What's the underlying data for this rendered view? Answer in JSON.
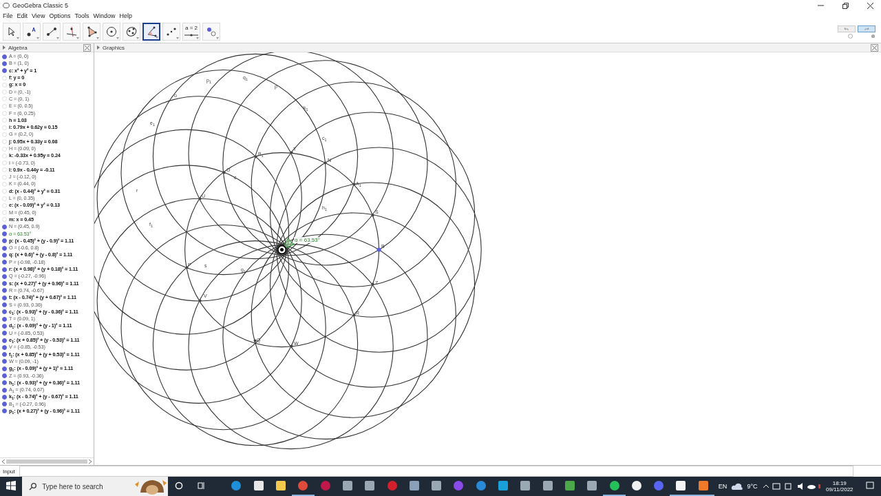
{
  "window": {
    "title": "GeoGebra Classic 5"
  },
  "menu": [
    "File",
    "Edit",
    "View",
    "Options",
    "Tools",
    "Window",
    "Help"
  ],
  "tools": [
    {
      "kind": "move",
      "selected": false
    },
    {
      "kind": "point",
      "selected": false
    },
    {
      "kind": "segment",
      "selected": false
    },
    {
      "kind": "perpendicular",
      "selected": false
    },
    {
      "kind": "polygon",
      "selected": false
    },
    {
      "kind": "circle",
      "selected": false
    },
    {
      "kind": "conic",
      "selected": false
    },
    {
      "kind": "angle",
      "selected": true
    },
    {
      "kind": "reflect",
      "selected": false
    },
    {
      "kind": "slider",
      "selected": false,
      "label": "a = 2"
    },
    {
      "kind": "show",
      "selected": false
    }
  ],
  "algebra": {
    "title": "Algebra",
    "rows": [
      {
        "text": "A = (0, 0)",
        "kind": "point",
        "visible": true
      },
      {
        "text": "B = (1, 0)",
        "kind": "point",
        "visible": true
      },
      {
        "text": "c: x² + y² = 1",
        "kind": "object",
        "visible": true
      },
      {
        "text": "f: y = 0",
        "kind": "object",
        "visible": false
      },
      {
        "text": "g: x = 0",
        "kind": "object",
        "visible": false
      },
      {
        "text": "D = (0, -1)",
        "kind": "point",
        "visible": false
      },
      {
        "text": "C = (0, 1)",
        "kind": "point",
        "visible": false
      },
      {
        "text": "E = (0, 0.5)",
        "kind": "point",
        "visible": false
      },
      {
        "text": "F = (0, 0.25)",
        "kind": "point",
        "visible": false
      },
      {
        "text": "h = 1.03",
        "kind": "object",
        "visible": false
      },
      {
        "text": "i: 0.79x + 0.62y = 0.15",
        "kind": "object",
        "visible": false
      },
      {
        "text": "G = (0.2, 0)",
        "kind": "point",
        "visible": false
      },
      {
        "text": "j: 0.95x + 0.33y = 0.08",
        "kind": "object",
        "visible": false
      },
      {
        "text": "H = (0.09, 0)",
        "kind": "point",
        "visible": false
      },
      {
        "text": "k: -0.33x + 0.95y = 0.24",
        "kind": "object",
        "visible": false
      },
      {
        "text": "I = (-0.73, 0)",
        "kind": "point",
        "visible": false
      },
      {
        "text": "l: 0.9x - 0.44y = -0.11",
        "kind": "object",
        "visible": false
      },
      {
        "text": "J = (-0.12, 0)",
        "kind": "point",
        "visible": false
      },
      {
        "text": "K = (0.44, 0)",
        "kind": "point",
        "visible": false
      },
      {
        "text": "d: (x - 0.44)² + y² = 0.31",
        "kind": "object",
        "visible": false
      },
      {
        "text": "L = (0, 0.35)",
        "kind": "point",
        "visible": false
      },
      {
        "text": "e: (x - 0.09)² + y² = 0.13",
        "kind": "object",
        "visible": false
      },
      {
        "text": "M = (0.45, 0)",
        "kind": "point",
        "visible": false
      },
      {
        "text": "m: x = 0.45",
        "kind": "object",
        "visible": false
      },
      {
        "text": "N = (0.45, 0.9)",
        "kind": "point",
        "visible": true
      },
      {
        "text": "α = 63.53°",
        "kind": "angle",
        "visible": true
      },
      {
        "text": "p: (x - 0.45)² + (y - 0.9)² = 1.11",
        "kind": "object",
        "visible": true
      },
      {
        "text": "O = (-0.6, 0.8)",
        "kind": "point",
        "visible": true
      },
      {
        "text": "q: (x + 0.6)² + (y - 0.8)² = 1.11",
        "kind": "object",
        "visible": true
      },
      {
        "text": "P = (-0.98, -0.18)",
        "kind": "point",
        "visible": true
      },
      {
        "text": "r: (x + 0.98)² + (y + 0.18)² = 1.11",
        "kind": "object",
        "visible": true
      },
      {
        "text": "Q = (-0.27, -0.96)",
        "kind": "point",
        "visible": true
      },
      {
        "text": "s: (x + 0.27)² + (y + 0.96)² = 1.11",
        "kind": "object",
        "visible": true
      },
      {
        "text": "R = (0.74, -0.67)",
        "kind": "point",
        "visible": true
      },
      {
        "text": "t: (x - 0.74)² + (y + 0.67)² = 1.11",
        "kind": "object",
        "visible": true
      },
      {
        "text": "S = (0.93, 0.36)",
        "kind": "point",
        "visible": true
      },
      {
        "text": "c$_{1}$: (x - 0.93)² + (y - 0.36)² = 1.11",
        "kind": "object",
        "visible": true
      },
      {
        "text": "T = (0.09, 1)",
        "kind": "point",
        "visible": true
      },
      {
        "text": "d$_{1}$: (x - 0.09)² + (y - 1)² = 1.11",
        "kind": "object",
        "visible": true
      },
      {
        "text": "U = (-0.85, 0.53)",
        "kind": "point",
        "visible": true
      },
      {
        "text": "e$_{1}$: (x + 0.85)² + (y - 0.53)² = 1.11",
        "kind": "object",
        "visible": true
      },
      {
        "text": "V = (-0.85, -0.53)",
        "kind": "point",
        "visible": true
      },
      {
        "text": "f$_{1}$: (x + 0.85)² + (y + 0.53)² = 1.11",
        "kind": "object",
        "visible": true
      },
      {
        "text": "W = (0.09, -1)",
        "kind": "point",
        "visible": true
      },
      {
        "text": "g$_{1}$: (x - 0.09)² + (y + 1)² = 1.11",
        "kind": "object",
        "visible": true
      },
      {
        "text": "Z = (0.93, -0.36)",
        "kind": "point",
        "visible": true
      },
      {
        "text": "h$_{1}$: (x - 0.93)² + (y + 0.36)² = 1.11",
        "kind": "object",
        "visible": true
      },
      {
        "text": "A$_{1}$ = (0.74, 0.67)",
        "kind": "point",
        "visible": true
      },
      {
        "text": "k$_{1}$: (x - 0.74)² + (y - 0.67)² = 1.11",
        "kind": "object",
        "visible": true
      },
      {
        "text": "B$_{1}$ = (-0.27, 0.96)",
        "kind": "point",
        "visible": true
      },
      {
        "text": "p$_{1}$: (x + 0.27)² + (y - 0.96)² = 1.11",
        "kind": "object",
        "visible": true
      }
    ]
  },
  "graphics": {
    "title": "Graphics",
    "angle_label": "α = 63.53°",
    "labels": [
      {
        "text": "o"
      },
      {
        "text": "p$_{1}$"
      },
      {
        "text": "q$_{1}$"
      },
      {
        "text": "p"
      },
      {
        "text": "k$_{1}$"
      },
      {
        "text": "e$_{1}$"
      },
      {
        "text": "c$_{1}$"
      },
      {
        "text": "B$_{1}$"
      },
      {
        "text": "T"
      },
      {
        "text": "N"
      },
      {
        "text": "O"
      },
      {
        "text": "c"
      },
      {
        "text": "A$_{1}$"
      },
      {
        "text": "U"
      },
      {
        "text": "r"
      },
      {
        "text": "h$_{1}$"
      },
      {
        "text": "S"
      },
      {
        "text": "f$_{1}$"
      },
      {
        "text": "B"
      },
      {
        "text": "P"
      },
      {
        "text": "s"
      },
      {
        "text": "g$_{1}$"
      },
      {
        "text": "Z"
      },
      {
        "text": "R"
      },
      {
        "text": "V"
      },
      {
        "text": "Q"
      },
      {
        "text": "W"
      }
    ]
  },
  "input": {
    "label": "Input"
  },
  "taskbar": {
    "search_placeholder": "Type here to search",
    "language": "EN",
    "temperature": "9°C",
    "time": "18:19",
    "date": "09/11/2022",
    "apps": [
      {
        "kind": "edge",
        "running": false
      },
      {
        "kind": "store",
        "running": false
      },
      {
        "kind": "folder",
        "running": false
      },
      {
        "kind": "chrome",
        "running": true
      },
      {
        "kind": "operagx",
        "running": false
      },
      {
        "kind": "tool",
        "running": false
      },
      {
        "kind": "tool",
        "running": false
      },
      {
        "kind": "opera",
        "running": false
      },
      {
        "kind": "calculator",
        "running": false
      },
      {
        "kind": "tool",
        "running": false
      },
      {
        "kind": "messenger",
        "running": false
      },
      {
        "kind": "ccleaner",
        "running": false
      },
      {
        "kind": "shield",
        "running": false
      },
      {
        "kind": "tool",
        "running": false
      },
      {
        "kind": "tool",
        "running": false
      },
      {
        "kind": "turtle",
        "running": false
      },
      {
        "kind": "tool",
        "running": false
      },
      {
        "kind": "whatsapp",
        "running": true
      },
      {
        "kind": "clock",
        "running": false
      },
      {
        "kind": "discord",
        "running": false
      },
      {
        "kind": "geogebra",
        "running": true
      },
      {
        "kind": "recorder",
        "running": true
      }
    ]
  }
}
